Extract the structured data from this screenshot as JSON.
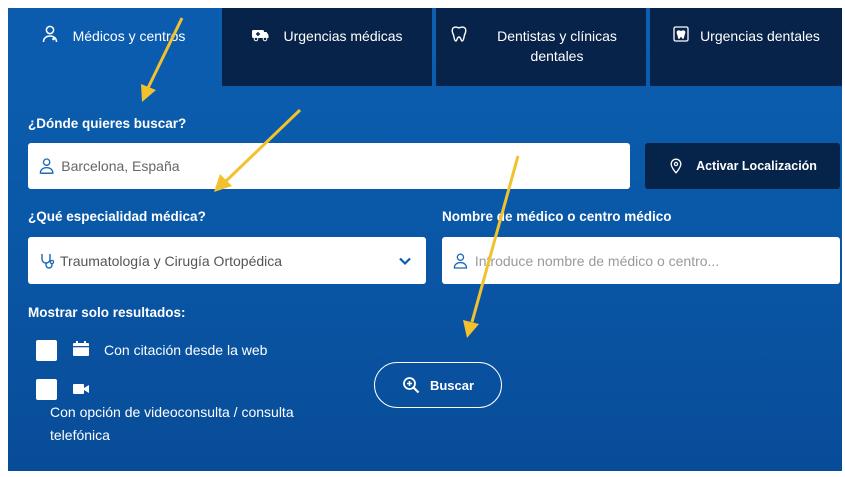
{
  "tabs": [
    {
      "label": "Médicos y centros",
      "icon": "doctor-icon"
    },
    {
      "label": "Urgencias médicas",
      "icon": "ambulance-icon"
    },
    {
      "label": "Dentistas y clínicas dentales",
      "icon": "tooth-icon"
    },
    {
      "label": "Urgencias dentales",
      "icon": "dental-emergency-icon"
    }
  ],
  "location": {
    "label": "¿Dónde quieres buscar?",
    "value": "Barcelona, España",
    "button_label": "Activar Localización"
  },
  "specialty": {
    "label": "¿Qué especialidad médica?",
    "value": "Traumatología y Cirugía Ortopédica"
  },
  "doctor_name": {
    "label": "Nombre de médico o centro médico",
    "placeholder": "Introduce nombre de médico o centro..."
  },
  "filters": {
    "title": "Mostrar solo resultados:",
    "options": [
      {
        "label": "Con citación desde la web",
        "icon": "calendar-icon"
      },
      {
        "label": "Con opción de videoconsulta / consulta telefónica",
        "icon": "video-camera-icon"
      }
    ]
  },
  "search_button": {
    "label": "Buscar"
  },
  "colors": {
    "panel_blue": "#0a58a8",
    "tab_dark": "#08234a",
    "annotation_arrow": "#f2c12e"
  }
}
